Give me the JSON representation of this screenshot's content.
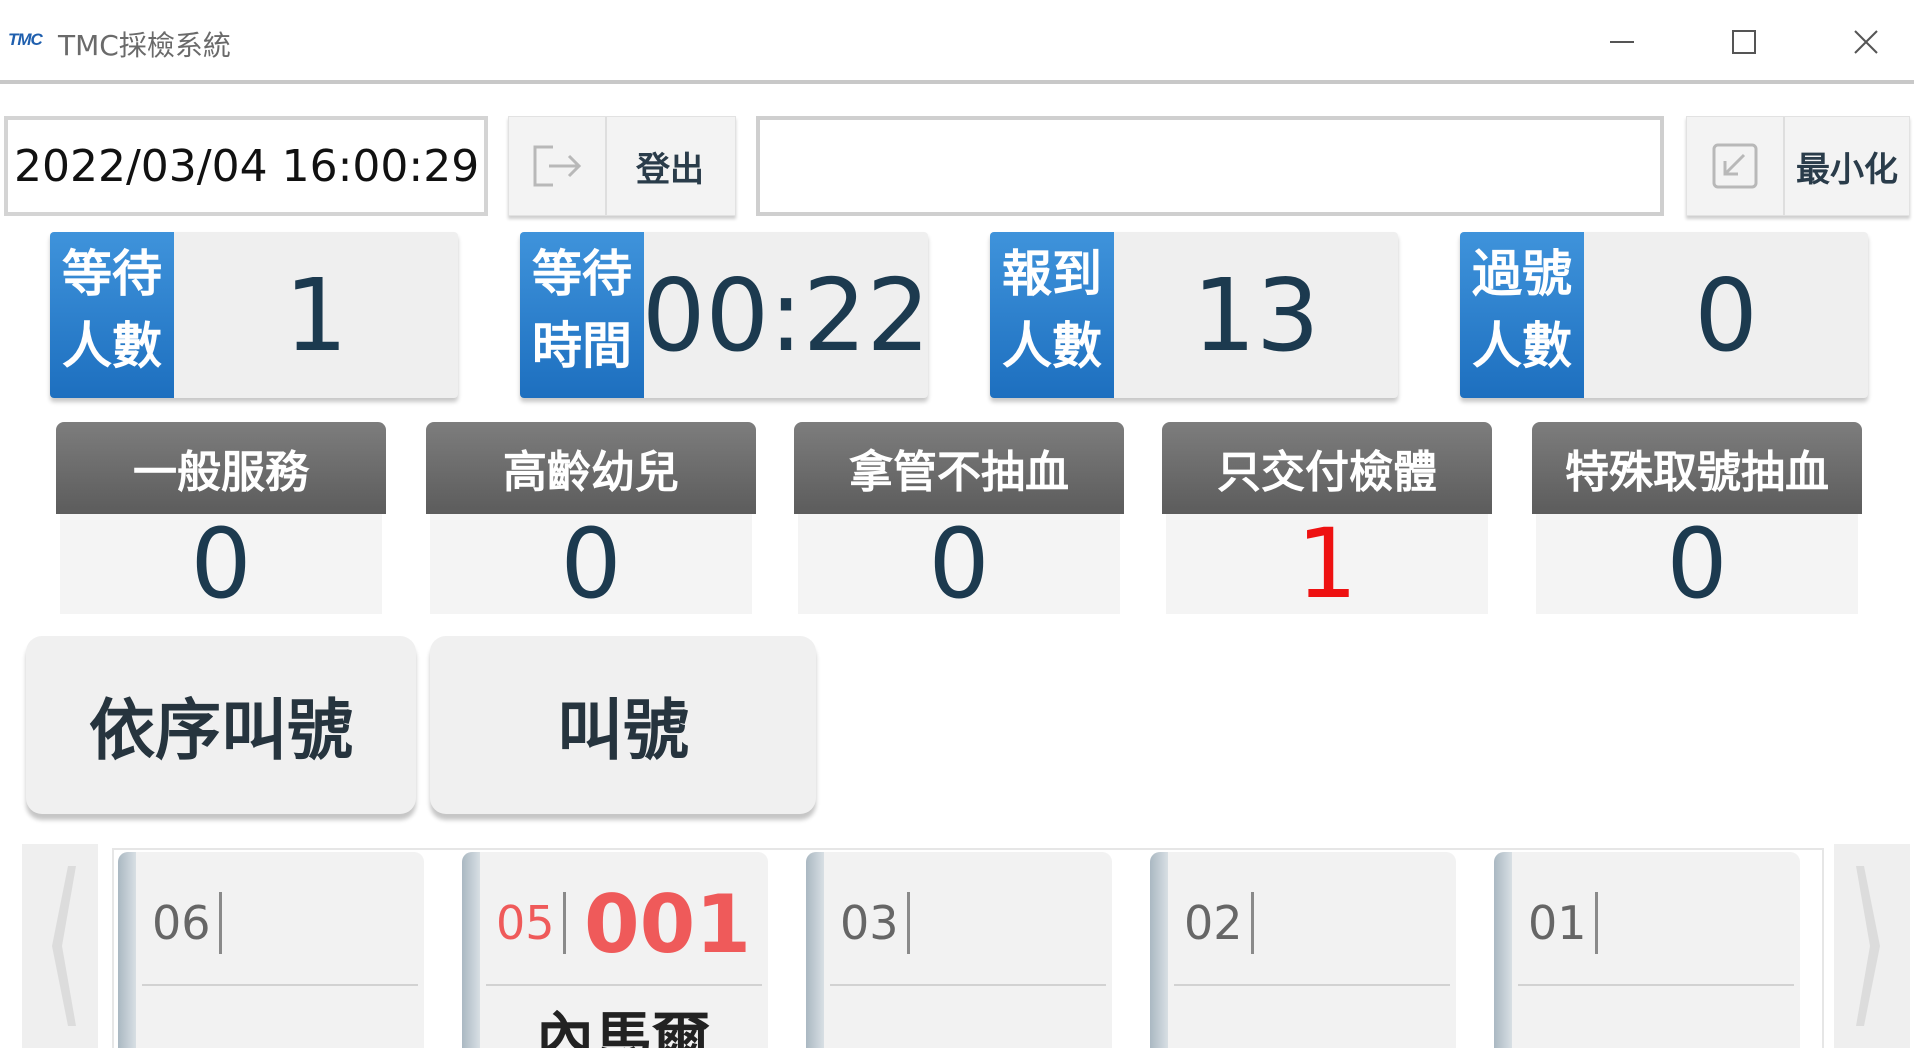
{
  "window": {
    "logo": "TMC",
    "title": "TMC採檢系統",
    "minimize_glyph": "minimize-icon",
    "maximize_glyph": "maximize-icon",
    "close_glyph": "close-icon"
  },
  "toolbar": {
    "datetime": "2022/03/04 16:00:29",
    "logout_label": "登出",
    "message": "",
    "minimize_label": "最小化"
  },
  "stats": [
    {
      "label_line1": "等待",
      "label_line2": "人數",
      "value": "1"
    },
    {
      "label_line1": "等待",
      "label_line2": "時間",
      "value": "00:22"
    },
    {
      "label_line1": "報到",
      "label_line2": "人數",
      "value": "13"
    },
    {
      "label_line1": "過號",
      "label_line2": "人數",
      "value": "0"
    }
  ],
  "categories": [
    {
      "label": "一般服務",
      "value": "0"
    },
    {
      "label": "高齡幼兒",
      "value": "0"
    },
    {
      "label": "拿管不抽血",
      "value": "0"
    },
    {
      "label": "只交付檢體",
      "value": "1"
    },
    {
      "label": "特殊取號抽血",
      "value": "0"
    }
  ],
  "actions": {
    "call_in_order_label": "依序叫號",
    "call_label": "叫號"
  },
  "counters": [
    {
      "no": "06",
      "ticket": "",
      "name": ""
    },
    {
      "no": "05",
      "ticket": "001",
      "name": "內馬爾"
    },
    {
      "no": "03",
      "ticket": "",
      "name": ""
    },
    {
      "no": "02",
      "ticket": "",
      "name": ""
    },
    {
      "no": "01",
      "ticket": "",
      "name": ""
    }
  ],
  "colors": {
    "stat_tag_blue": "#2a7fcf",
    "category_header_gray": "#6a6a6a",
    "highlight_red": "#ee1111",
    "active_counter_red": "#ef5a5a"
  }
}
